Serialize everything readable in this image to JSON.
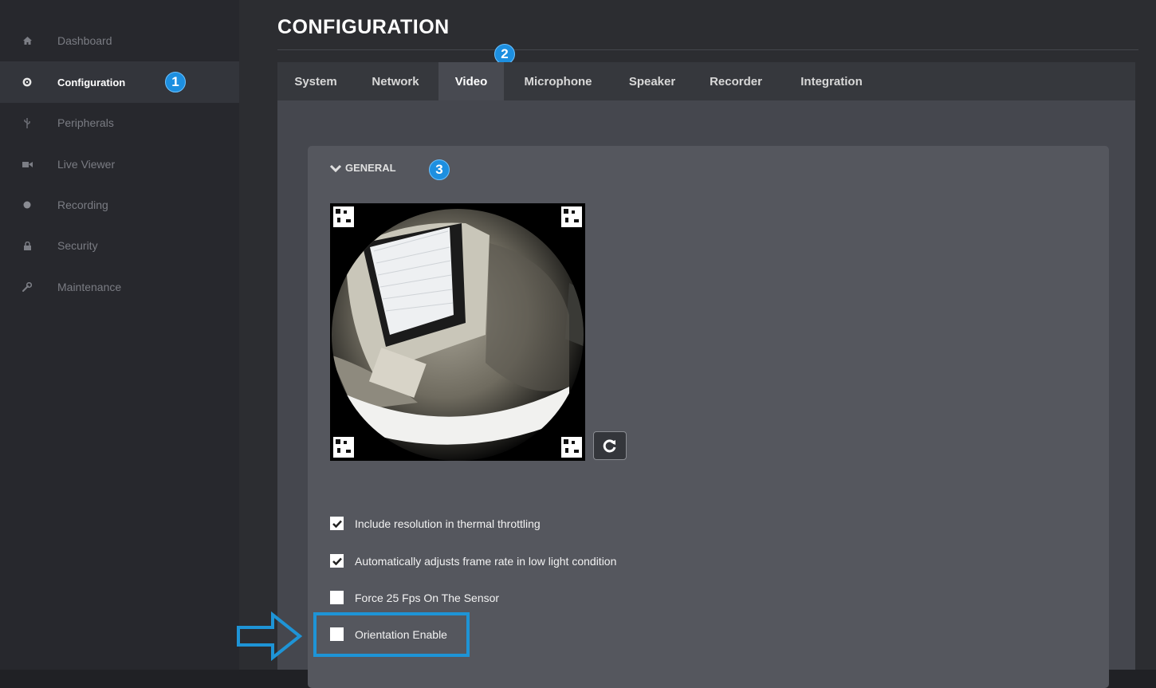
{
  "sidebar": {
    "items": [
      {
        "label": "Dashboard",
        "icon": "home-icon"
      },
      {
        "label": "Configuration",
        "icon": "gear-icon",
        "active": true
      },
      {
        "label": "Peripherals",
        "icon": "usb-icon"
      },
      {
        "label": "Live Viewer",
        "icon": "video-camera-icon"
      },
      {
        "label": "Recording",
        "icon": "record-dot-icon"
      },
      {
        "label": "Security",
        "icon": "lock-icon"
      },
      {
        "label": "Maintenance",
        "icon": "wrench-icon"
      }
    ]
  },
  "header": {
    "title": "CONFIGURATION"
  },
  "tabs": [
    {
      "label": "System"
    },
    {
      "label": "Network"
    },
    {
      "label": "Video",
      "active": true
    },
    {
      "label": "Microphone"
    },
    {
      "label": "Speaker"
    },
    {
      "label": "Recorder"
    },
    {
      "label": "Integration"
    }
  ],
  "callouts": [
    "1",
    "2",
    "3"
  ],
  "section": {
    "title": "GENERAL",
    "expanded": true
  },
  "options": [
    {
      "label": "Include resolution in thermal throttling",
      "checked": true
    },
    {
      "label": "Automatically adjusts frame rate in low light condition",
      "checked": true
    },
    {
      "label": "Force 25 Fps On The Sensor",
      "checked": false
    },
    {
      "label": "Orientation Enable",
      "checked": false
    }
  ],
  "colors": {
    "accent": "#1d8fe0",
    "highlight": "#1e94d6",
    "background": "#2c2d31",
    "sidebar": "#27282d"
  }
}
